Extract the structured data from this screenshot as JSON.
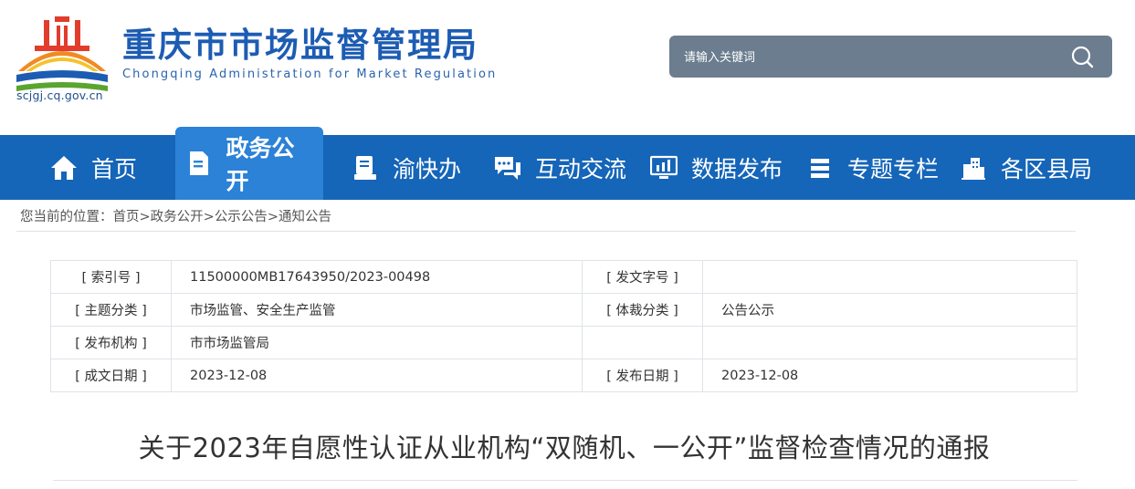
{
  "header": {
    "site_title": "重庆市市场监督管理局",
    "site_subtitle": "Chongqing  Administration for Market Regulation",
    "domain": "scjgj.cq.gov.cn",
    "search_placeholder": "请输入关键词",
    "logo_colors": {
      "orange": "#f08a24",
      "red": "#e23c2d",
      "blue": "#1d5cb3",
      "green": "#5aa52f",
      "yellow": "#f6c22c"
    }
  },
  "nav": {
    "background": "#1565b8",
    "active_background": "#2b82d6",
    "items": [
      {
        "label": "首页",
        "icon": "home-icon"
      },
      {
        "label": "政务公开",
        "icon": "document-icon",
        "active": true
      },
      {
        "label": "渝快办",
        "icon": "handbook-icon"
      },
      {
        "label": "互动交流",
        "icon": "chat-icon"
      },
      {
        "label": "数据发布",
        "icon": "monitor-chart-icon"
      },
      {
        "label": "专题专栏",
        "icon": "stack-icon"
      },
      {
        "label": "各区县局",
        "icon": "buildings-icon"
      }
    ]
  },
  "breadcrumb": {
    "prefix": "您当前的位置：",
    "items": [
      "首页",
      "政务公开",
      "公示公告",
      "通知公告"
    ],
    "separator": ">"
  },
  "meta": {
    "rows": [
      {
        "k1": "[ 索引号 ]",
        "v1": "11500000MB17643950/2023-00498",
        "k2": "[ 发文字号 ]",
        "v2": ""
      },
      {
        "k1": "[ 主题分类 ]",
        "v1": "市场监管、安全生产监管",
        "k2": "[ 体裁分类 ]",
        "v2": "公告公示"
      },
      {
        "k1": "[ 发布机构 ]",
        "v1": "市市场监管局",
        "k2": "",
        "v2": ""
      },
      {
        "k1": "[ 成文日期 ]",
        "v1": "2023-12-08",
        "k2": "[ 发布日期 ]",
        "v2": "2023-12-08"
      }
    ]
  },
  "article": {
    "title": "关于2023年自愿性认证从业机构“双随机、一公开”监督检查情况的通报"
  }
}
